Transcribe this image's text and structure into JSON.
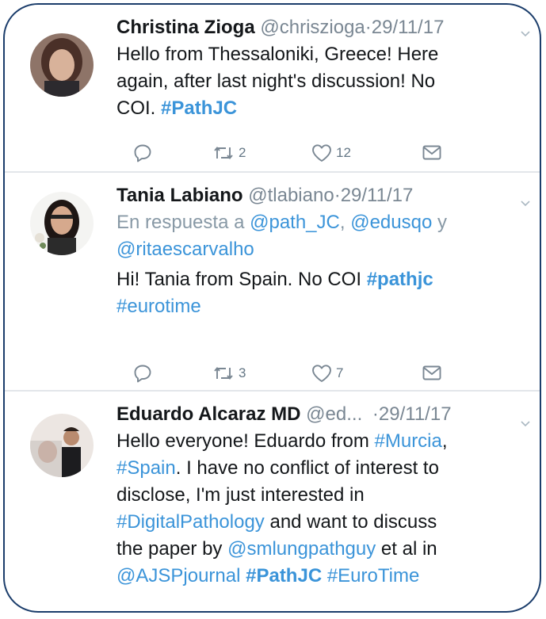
{
  "tweets": [
    {
      "name": "Christina Zioga",
      "handle": "@chriszioga",
      "separator": "·",
      "date": "29/11/17",
      "text_lines": [
        [
          {
            "t": "Hello from Thessaloniki, Greece! Here",
            "k": "text"
          }
        ],
        [
          {
            "t": "again, after last night's discussion! No",
            "k": "text"
          }
        ],
        [
          {
            "t": "COI. ",
            "k": "text"
          },
          {
            "t": "#PathJC",
            "k": "bold-link"
          }
        ]
      ],
      "retweets": "2",
      "likes": "12"
    },
    {
      "name": "Tania Labiano",
      "handle": "@tlabiano",
      "separator": "·",
      "date": "29/11/17",
      "reply_lines": [
        [
          {
            "t": "En respuesta a ",
            "k": "reply"
          },
          {
            "t": "@path_JC",
            "k": "link"
          },
          {
            "t": ", ",
            "k": "reply"
          },
          {
            "t": "@edusqo",
            "k": "link"
          },
          {
            "t": " y",
            "k": "reply"
          }
        ],
        [
          {
            "t": "@ritaescarvalho",
            "k": "link"
          }
        ]
      ],
      "text_lines": [
        [
          {
            "t": "Hi! Tania from Spain. No COI ",
            "k": "text"
          },
          {
            "t": "#pathjc",
            "k": "bold-link"
          }
        ],
        [
          {
            "t": "#eurotime",
            "k": "link"
          }
        ]
      ],
      "retweets": "3",
      "likes": "7"
    },
    {
      "name": "Eduardo Alcaraz MD",
      "handle": "@ed...",
      "separator": "·",
      "date": "29/11/17",
      "text_lines": [
        [
          {
            "t": "Hello everyone! Eduardo from ",
            "k": "text"
          },
          {
            "t": "#Murcia",
            "k": "link"
          },
          {
            "t": ",",
            "k": "text"
          }
        ],
        [
          {
            "t": "#Spain",
            "k": "link"
          },
          {
            "t": ". I have no conflict of interest to",
            "k": "text"
          }
        ],
        [
          {
            "t": "disclose, I'm just interested in",
            "k": "text"
          }
        ],
        [
          {
            "t": "#DigitalPathology",
            "k": "link"
          },
          {
            "t": " and want to discuss",
            "k": "text"
          }
        ],
        [
          {
            "t": "the paper by ",
            "k": "text"
          },
          {
            "t": "@smlungpathguy",
            "k": "link"
          },
          {
            "t": " et al in",
            "k": "text"
          }
        ],
        [
          {
            "t": "@AJSPjournal",
            "k": "link"
          },
          {
            "t": " ",
            "k": "text"
          },
          {
            "t": "#PathJC",
            "k": "bold-link"
          },
          {
            "t": " ",
            "k": "text"
          },
          {
            "t": "#EuroTime",
            "k": "link"
          }
        ]
      ]
    }
  ],
  "icons": {
    "reply": "reply-icon",
    "retweet": "retweet-icon",
    "like": "heart-icon",
    "message": "direct-message-icon",
    "caret": "chevron-down-icon"
  },
  "colors": {
    "link": "#3b94d9",
    "text": "#14171a",
    "muted": "#7a8793",
    "border": "#1b3d6b"
  }
}
